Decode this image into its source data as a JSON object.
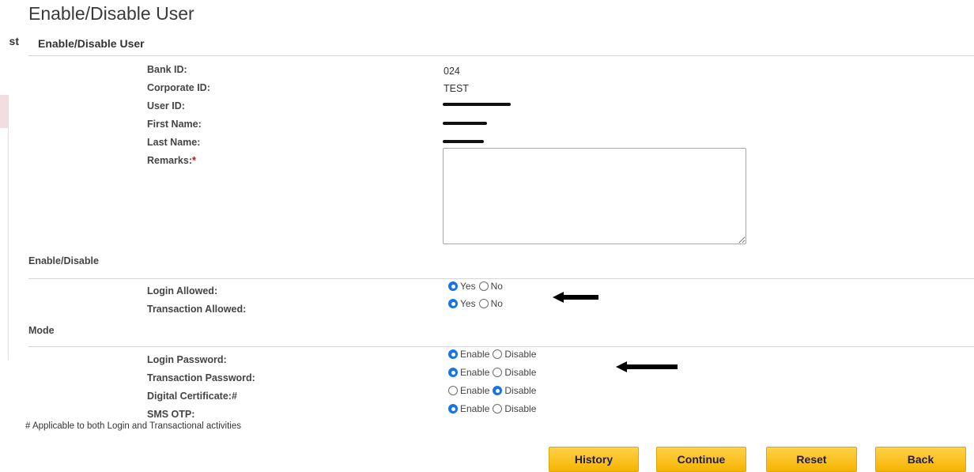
{
  "page": {
    "title": "Enable/Disable User",
    "cutoff_fragment": "st"
  },
  "section": {
    "title": "Enable/Disable User"
  },
  "details": [
    {
      "label": "Bank ID:",
      "value": "024"
    },
    {
      "label": "Corporate ID:",
      "value": "TEST"
    },
    {
      "label": "User ID:",
      "value": ""
    },
    {
      "label": "First Name:",
      "value": ""
    },
    {
      "label": "Last Name:",
      "value": ""
    }
  ],
  "remarks": {
    "label": "Remarks:",
    "required_mark": "*",
    "value": ""
  },
  "enable_disable": {
    "group_label": "Enable/Disable",
    "rows": [
      {
        "label": "Login Allowed:",
        "options": [
          "Yes",
          "No"
        ],
        "selected": "Yes"
      },
      {
        "label": "Transaction Allowed:",
        "options": [
          "Yes",
          "No"
        ],
        "selected": "Yes"
      }
    ]
  },
  "mode": {
    "group_label": "Mode",
    "rows": [
      {
        "label": "Login Password:",
        "options": [
          "Enable",
          "Disable"
        ],
        "selected": "Enable"
      },
      {
        "label": "Transaction Password:",
        "options": [
          "Enable",
          "Disable"
        ],
        "selected": "Enable"
      },
      {
        "label": "Digital Certificate:#",
        "options": [
          "Enable",
          "Disable"
        ],
        "selected": "Disable"
      },
      {
        "label": "SMS OTP:",
        "options": [
          "Enable",
          "Disable"
        ],
        "selected": "Enable"
      }
    ]
  },
  "footnote": "# Applicable to both Login and Transactional activities",
  "buttons": {
    "history": "History",
    "continue": "Continue",
    "reset": "Reset",
    "back": "Back"
  },
  "colors": {
    "button_bg": "#f5b400",
    "button_text": "#1c1c5c",
    "radio_selected": "#1a73e8",
    "required": "#d00000"
  },
  "icons": [
    "left-arrow-icon",
    "resize-handle-icon"
  ]
}
